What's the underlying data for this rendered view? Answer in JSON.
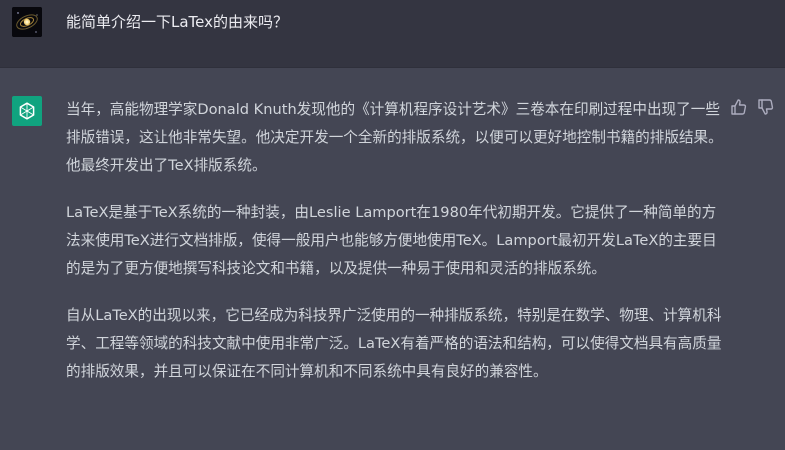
{
  "user": {
    "avatar_icon": "galaxy-avatar-icon",
    "message": "能简单介绍一下LaTex的由来吗？"
  },
  "assistant": {
    "avatar_icon": "openai-logo-icon",
    "paragraphs": [
      "当年，高能物理学家Donald Knuth发现他的《计算机程序设计艺术》三卷本在印刷过程中出现了一些排版错误，这让他非常失望。他决定开发一个全新的排版系统，以便可以更好地控制书籍的排版结果。他最终开发出了TeX排版系统。",
      "LaTeX是基于TeX系统的一种封装，由Leslie Lamport在1980年代初期开发。它提供了一种简单的方法来使用TeX进行文档排版，使得一般用户也能够方便地使用TeX。Lamport最初开发LaTeX的主要目的是为了更方便地撰写科技论文和书籍，以及提供一种易于使用和灵活的排版系统。",
      "自从LaTeX的出现以来，它已经成为科技界广泛使用的一种排版系统，特别是在数学、物理、计算机科学、工程等领域的科技文献中使用非常广泛。LaTeX有着严格的语法和结构，可以使得文档具有高质量的排版效果，并且可以保证在不同计算机和不同系统中具有良好的兼容性。"
    ]
  },
  "feedback": {
    "up_icon": "thumbs-up-icon",
    "down_icon": "thumbs-down-icon"
  },
  "colors": {
    "user_bg": "#343541",
    "assistant_bg": "#444654",
    "accent": "#10a37f",
    "text": "#d1d5db"
  }
}
